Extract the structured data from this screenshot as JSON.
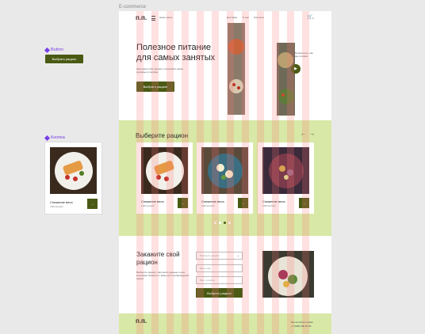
{
  "frame_label": "E-commerce",
  "components": {
    "button_label": "Button",
    "card_label": "Кнопка",
    "button_text": "Выбрать рацион",
    "card_title": "Снижение веса",
    "card_sub": "1300 калорий"
  },
  "header": {
    "logo": "п.п.",
    "nav_left": "Наше меню",
    "nav_items": [
      "Доставка",
      "О нас",
      "Контакты"
    ],
    "cart_count": "0"
  },
  "hero": {
    "title": "Полезное питание для самых занятых",
    "subtitle": "Экономьте свое время и сохраняйте ваше здоровье в порядке",
    "button": "Выбрать рацион",
    "note": "Посмотрите, как мы готовим"
  },
  "menu": {
    "title": "Выберите рацион",
    "prev": "←",
    "next": "→",
    "cards": [
      {
        "title": "Снижение веса",
        "sub": "1300 калорий"
      },
      {
        "title": "Снижение веса",
        "sub": "1300 калорий"
      },
      {
        "title": "Снижение веса",
        "sub": "1300 калорий"
      }
    ]
  },
  "order": {
    "title": "Закажите свой рацион",
    "desc": "Выберите рацион, заполните данные и наш менеджер свяжется с вами для подтверждения заказа",
    "fields": [
      "Выберите рацион",
      "Ваше имя",
      "Ваш телефон"
    ],
    "button": "Выбрать рацион"
  },
  "footer": {
    "logo": "п.п.",
    "line1": "Мы на связи с вами",
    "line2": "+7 (000) 000 00 00"
  },
  "colors": {
    "accent": "#4a5a14",
    "green_bg": "#d8e8a6"
  }
}
